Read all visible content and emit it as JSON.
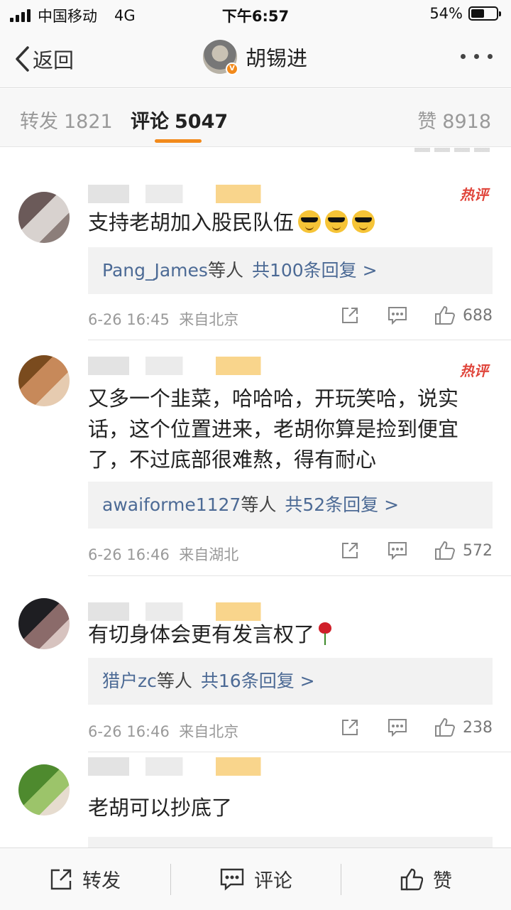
{
  "status_bar": {
    "carrier": "中国移动",
    "network": "4G",
    "time": "下午6:57",
    "battery_percent": "54%",
    "battery_level": 0.54
  },
  "nav": {
    "back_label": "返回",
    "title": "胡锡进"
  },
  "tabs": [
    {
      "label": "转发",
      "count": "1821"
    },
    {
      "label": "评论",
      "count": "5047"
    },
    {
      "label": "赞",
      "count": "8918"
    }
  ],
  "comments": [
    {
      "badge": "热评",
      "text": "支持老胡加入股民队伍",
      "replies_who": "Pang_James",
      "replies_etc": "等人",
      "replies_count": "共100条回复 >",
      "time": "6-26 16:45",
      "source": "来自北京",
      "likes": "688"
    },
    {
      "badge": "热评",
      "text": "又多一个韭菜，哈哈哈，开玩笑哈，说实话，这个位置进来，老胡你算是捡到便宜了，不过底部很难熬，得有耐心",
      "replies_who": "awaiforme1127",
      "replies_etc": "等人",
      "replies_count": "共52条回复 >",
      "time": "6-26 16:46",
      "source": "来自湖北",
      "likes": "572"
    },
    {
      "text": "有切身体会更有发言权了",
      "replies_who": "猎户zc",
      "replies_etc": "等人",
      "replies_count": "共16条回复 >",
      "time": "6-26 16:46",
      "source": "来自北京",
      "likes": "238"
    },
    {
      "text": "老胡可以抄底了"
    }
  ],
  "bottom_bar": {
    "repost_label": "转发",
    "comment_label": "评论",
    "like_label": "赞"
  },
  "colors": {
    "accent": "#f28a1c",
    "link": "#4c6a95",
    "hot": "#e0463c"
  },
  "icons": [
    "back-chevron-icon",
    "more-icon",
    "share-icon",
    "comment-icon",
    "like-icon",
    "verified-icon"
  ]
}
